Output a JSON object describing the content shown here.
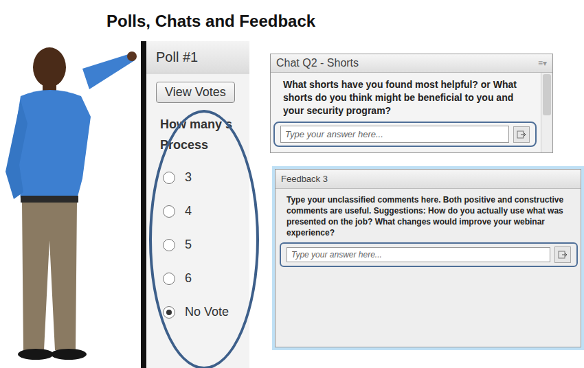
{
  "title": "Polls, Chats and Feedback",
  "poll": {
    "title": "Poll #1",
    "button": "View Votes",
    "question": [
      "How many s",
      "Process"
    ],
    "options": [
      {
        "label": "3",
        "selected": false
      },
      {
        "label": "4",
        "selected": false
      },
      {
        "label": "5",
        "selected": false
      },
      {
        "label": "6",
        "selected": false
      },
      {
        "label": "No Vote",
        "selected": true
      }
    ]
  },
  "chat": {
    "title": "Chat Q2 - Shorts",
    "menu": "≡▾",
    "question": "What shorts have you found most helpful? or What shorts do you think might be beneficial to you and your security program?",
    "placeholder": "Type your answer here..."
  },
  "feedback": {
    "title": "Feedback 3",
    "question": "Type your unclassified comments here. Both positive and constructive comments are useful. Suggestions: How do you actually use what was presented on the job? What changes would improve your webinar experience?",
    "placeholder": "Type your answer here..."
  }
}
